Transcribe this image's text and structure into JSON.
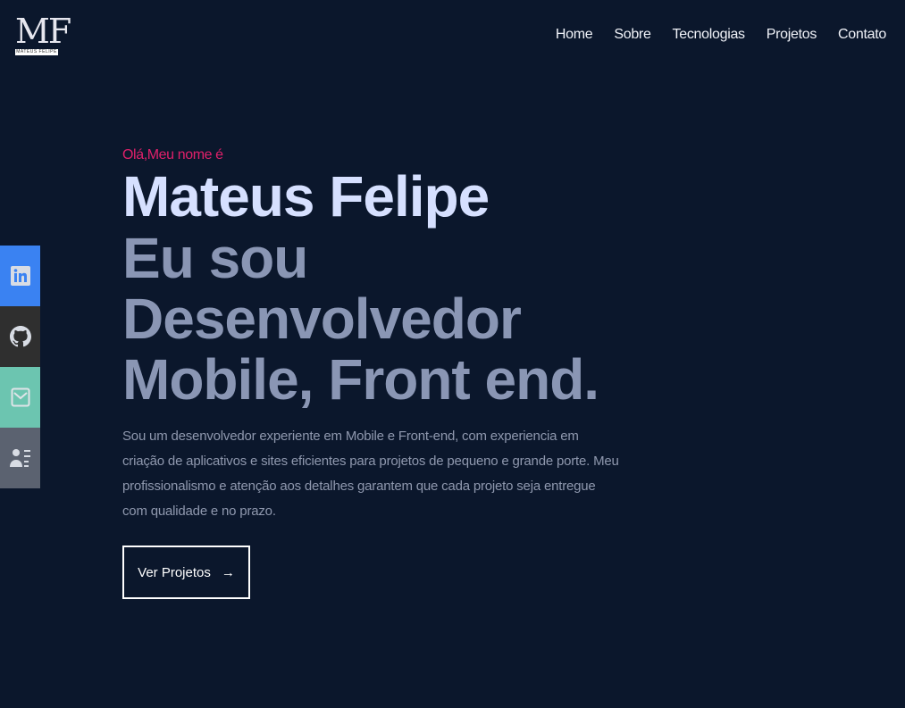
{
  "logo": {
    "mark": "MF",
    "text": "MATEUS FELIPE"
  },
  "nav": [
    "Home",
    "Sobre",
    "Tecnologias",
    "Projetos",
    "Contato"
  ],
  "social": [
    {
      "icon": "linkedin-icon",
      "color": "#3a82f2"
    },
    {
      "icon": "github-icon",
      "color": "#2f2f2f"
    },
    {
      "icon": "mail-icon",
      "color": "#6cc5b0"
    },
    {
      "icon": "resume-icon",
      "color": "#5b6270"
    }
  ],
  "hero": {
    "greeting": "Olá,Meu nome é",
    "name": "Mateus Felipe",
    "role_line1": "Eu sou Desenvolvedor",
    "role_line2": "Mobile, Front end.",
    "description": "Sou um desenvolvedor experiente em Mobile e Front-end, com experiencia em criação de aplicativos e sites eficientes para projetos de pequeno e grande porte. Meu profissionalismo e atenção aos detalhes garantem que cada projeto seja entregue com qualidade e no prazo.",
    "button_label": "Ver Projetos",
    "button_arrow": "→"
  }
}
